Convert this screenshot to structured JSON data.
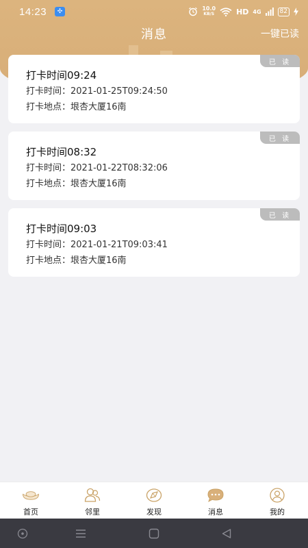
{
  "status_bar": {
    "time": "14:23",
    "speed_value": "10.0",
    "speed_unit": "KB/S",
    "hd": "HD",
    "network": "4G",
    "battery": "82"
  },
  "header": {
    "title": "消息",
    "mark_all_read": "一键已读"
  },
  "messages": [
    {
      "title": "打卡时间09:24",
      "time_label": "打卡时间：",
      "time_value": "2021-01-25T09:24:50",
      "place_label": "打卡地点：",
      "place_value": "垠杏大厦16南",
      "tag": "已 读"
    },
    {
      "title": "打卡时间08:32",
      "time_label": "打卡时间：",
      "time_value": "2021-01-22T08:32:06",
      "place_label": "打卡地点：",
      "place_value": "垠杏大厦16南",
      "tag": "已 读"
    },
    {
      "title": "打卡时间09:03",
      "time_label": "打卡时间：",
      "time_value": "2021-01-21T09:03:41",
      "place_label": "打卡地点：",
      "place_value": "垠杏大厦16南",
      "tag": "已 读"
    }
  ],
  "bottom_nav": {
    "items": [
      {
        "label": "首页",
        "icon": "home-ingot-icon"
      },
      {
        "label": "邻里",
        "icon": "neighbors-icon"
      },
      {
        "label": "发现",
        "icon": "discover-compass-icon"
      },
      {
        "label": "消息",
        "icon": "message-bubble-icon"
      },
      {
        "label": "我的",
        "icon": "profile-icon"
      }
    ]
  },
  "colors": {
    "header_gold": "#d9b07a",
    "nav_active": "#c9a266",
    "read_tag": "#bcbcbc"
  }
}
